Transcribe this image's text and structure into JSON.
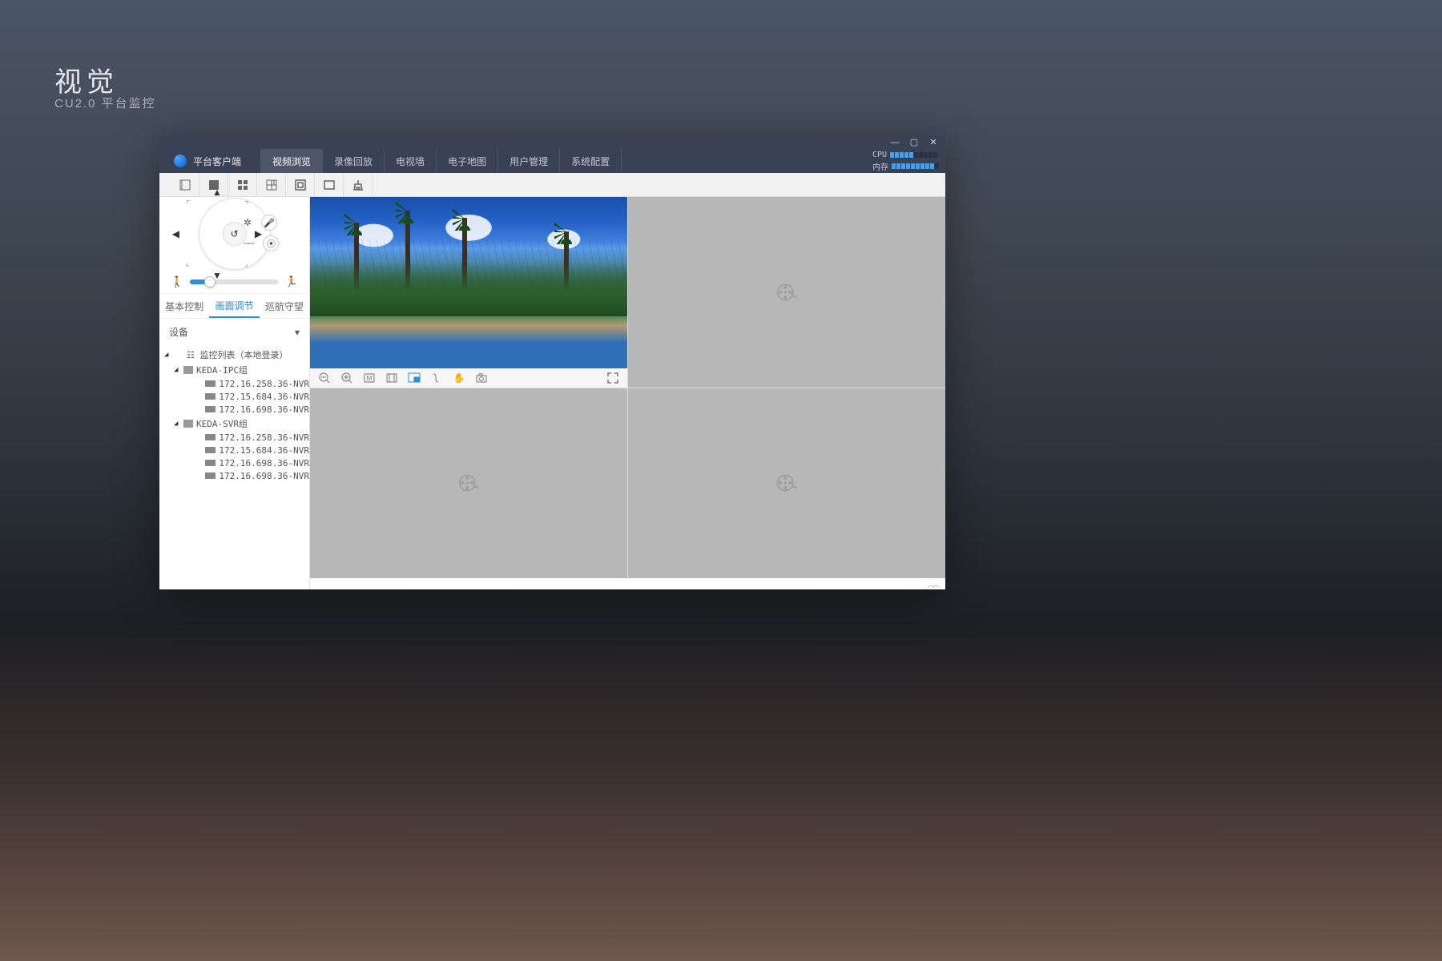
{
  "header": {
    "title": "视觉",
    "subtitle": "CU2.0 平台监控"
  },
  "window_controls": {
    "minimize": "—",
    "maximize": "▢",
    "close": "✕"
  },
  "brand": "平台客户端",
  "nav": {
    "items": [
      "视频浏览",
      "录像回放",
      "电视墙",
      "电子地图",
      "用户管理",
      "系统配置"
    ],
    "active_index": 0
  },
  "sysmon": {
    "cpu_label": "CPU",
    "mem_label": "内存",
    "cpu_level": 5,
    "mem_level": 9,
    "total": 10
  },
  "subtabs": {
    "items": [
      "基本控制",
      "画面调节",
      "巡航守望"
    ],
    "active_index": 1
  },
  "devices": {
    "heading": "设备",
    "root": "监控列表（本地登录）",
    "groups": [
      {
        "name": "KEDA-IPC组",
        "items": [
          "172.16.258.36-NVR",
          "172.15.684.36-NVR",
          "172.16.698.36-NVR"
        ]
      },
      {
        "name": "KEDA-SVR组",
        "items": [
          "172.16.258.36-NVR",
          "172.15.684.36-NVR",
          "172.16.698.36-NVR",
          "172.16.698.36-NVR"
        ]
      }
    ]
  },
  "ptz": {
    "zoom_in": "▲",
    "zoom_out": "┄┄",
    "tree": "✲"
  },
  "slider_value_pct": 22
}
